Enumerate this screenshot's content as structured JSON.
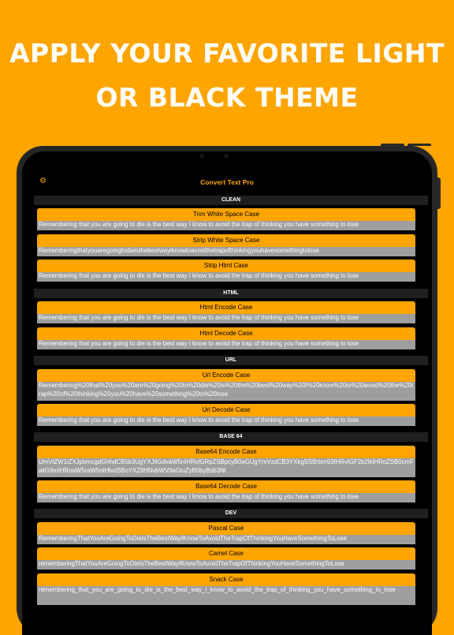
{
  "headline": {
    "line1": "APPLY YOUR FAVORITE LIGHT",
    "line2": "OR BLACK THEME"
  },
  "app": {
    "title": "Convert Text Pro",
    "settings_icon": "gear-icon",
    "accent": "#FFA500",
    "output_bg": "#9E9E9E"
  },
  "sections": [
    {
      "title": "CLEAN",
      "items": [
        {
          "label": "Trim White Space Case",
          "output": "Remembering that you are going to die is the best way I know to avoid the trap of thinking you have something to lose"
        },
        {
          "label": "Strip White Space Case",
          "output": "Rememberingthatyouaregoingtodieisthebestwayiknowtoavoidthetrapofthinkingyouhavesomethingtolose"
        },
        {
          "label": "Strip Html Case",
          "output": "Remembering that you are going to die is the best way I know to avoid the trap of thinking you have something to lose"
        }
      ]
    },
    {
      "title": "HTML",
      "items": [
        {
          "label": "Html Encode Case",
          "output": "Remembering that you are going to die is the best way I know to avoid the trap of thinking you have something to lose"
        },
        {
          "label": "Html Decode Case",
          "output": "Remembering that you are going to die is the best way I know to avoid the trap of thinking you have something to lose"
        }
      ]
    },
    {
      "title": "URL",
      "items": [
        {
          "label": "Url Encode Case",
          "output": "Remembering%20that%20you%20are%20going%20to%20die%20is%20the%20best%20way%20I%20know%20to%20avoid%20the%20trap%20of%20thinking%20you%20have%20something%20to%20lose"
        },
        {
          "label": "Url Decode Case",
          "output": "Remembering that you are going to die is the best way I know to avoid the trap of thinking you have something to lose"
        }
      ]
    },
    {
      "title": "BASE 64",
      "items": [
        {
          "label": "Base64 Encode Case",
          "output": "UmVtZW1iZXJpbmcgdGhhdCB5b3UgYXJlIGdvaW5nIHRvIGRpZSBpcyB0aGUgYmVzdCB3YXkgSSBrbm93IHRvIGF2b2lkIHRoZSB0cmFwIG9mIHRoaW5raW5nIHlvdSBoYXZlIHNvbWV0aGluZyB0byBsb3Nl"
        },
        {
          "label": "Base64 Decode Case",
          "output": "Remembering that you are going to die is the best way I know to avoid the trap of thinking you have something to lose"
        }
      ]
    },
    {
      "title": "DEV",
      "items": [
        {
          "label": "Pascal Case",
          "output": "RememberingThatYouAreGoingToDieIsTheBestWayIKnowToAvoidTheTrapOfThinkingYouHaveSomethingToLose"
        },
        {
          "label": "Camel Case",
          "output": "rememberingThatYouAreGoingToDieIsTheBestWayIKnowToAvoidTheTrapOfThinkingYouHaveSomethingToLose"
        },
        {
          "label": "Snack Case",
          "output": "remembering_that_you_are_going_to_die_is_the_best_way_i_know_to_avoid_the_trap_of_thinking_you_have_something_to_lose"
        }
      ]
    }
  ]
}
